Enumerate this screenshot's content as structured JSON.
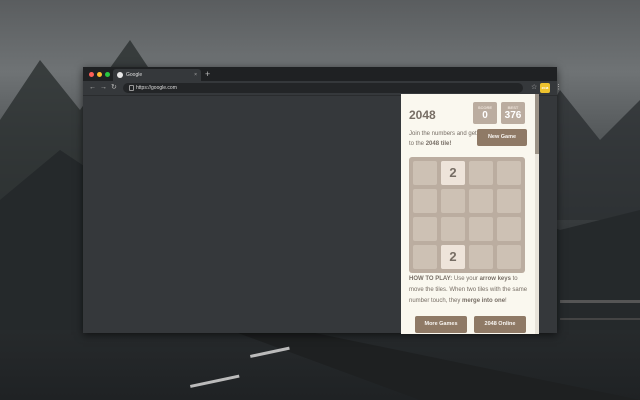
{
  "browser": {
    "tab_title": "Google",
    "tab_close": "×",
    "new_tab": "+",
    "url": "https://google.com",
    "back": "←",
    "forward": "→",
    "reload": "↻",
    "star": "☆",
    "ext_label": "2048",
    "menu": "⋮"
  },
  "game": {
    "title": "2048",
    "score_label": "SCORE",
    "score": "0",
    "best_label": "BEST",
    "best": "376",
    "intro_text": "Join the numbers and get to the ",
    "intro_bold": "2048 tile!",
    "new_game": "New Game",
    "howto_label": "HOW TO PLAY:",
    "howto_1": " Use your ",
    "howto_keys": "arrow keys",
    "howto_2": " to move the tiles. When two tiles with the same number touch, they ",
    "howto_merge": "merge into one",
    "howto_3": "!",
    "tile_1": "2",
    "tile_2": "2",
    "more_games": "More Games",
    "online": "2048 Online"
  }
}
